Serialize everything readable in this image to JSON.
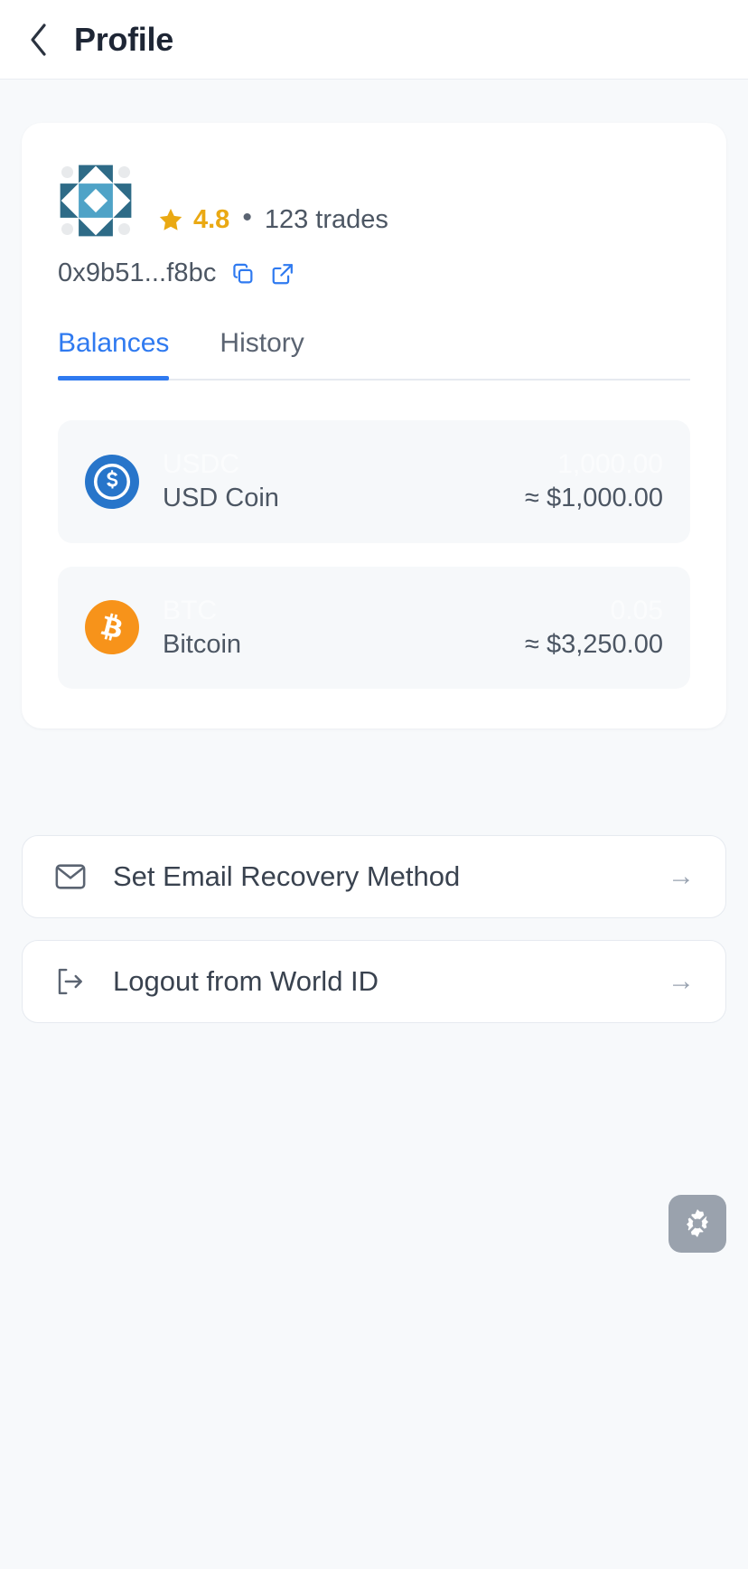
{
  "header": {
    "back_icon": "chevron-left-icon",
    "title": "Profile"
  },
  "profile": {
    "avatar_icon": "identicon-avatar",
    "avatar_colors": {
      "background": "#ffffff",
      "primary": "#2e6b87",
      "secondary": "#4fa3c7",
      "tertiary": "#e8eaec"
    },
    "rating": {
      "star_icon": "star-icon",
      "value": "4.8",
      "separator": "•",
      "trades": "123 trades",
      "star_color": "#eaa913"
    },
    "address": {
      "value": "0x9b51...f8bc",
      "copy_icon": "copy-icon",
      "external_icon": "external-link-icon",
      "icon_color": "#2f7af0"
    }
  },
  "tabs": {
    "active_color": "#2f7af0",
    "items": [
      {
        "label": "Balances",
        "active": true
      },
      {
        "label": "History",
        "active": false
      }
    ]
  },
  "balances": [
    {
      "icon": "usdc-icon",
      "icon_color": "#2775ca",
      "symbol": "USDC",
      "name": "USD Coin",
      "amount": "1,000.00",
      "fiat": "≈ $1,000.00"
    },
    {
      "icon": "bitcoin-icon",
      "icon_color": "#f7931a",
      "symbol": "BTC",
      "name": "Bitcoin",
      "amount": "0.05",
      "fiat": "≈ $3,250.00"
    }
  ],
  "actions": [
    {
      "icon": "envelope-icon",
      "label": "Set Email Recovery Method",
      "arrow": "→"
    },
    {
      "icon": "logout-icon",
      "label": "Logout from World ID",
      "arrow": "→"
    }
  ],
  "settings_fab": {
    "icon": "gear-off-icon",
    "background": "#9aa2ad"
  }
}
